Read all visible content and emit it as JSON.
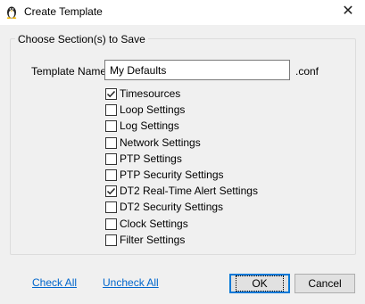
{
  "window": {
    "title": "Create Template",
    "icon": "penguin-icon",
    "close_glyph": "✕"
  },
  "group": {
    "title": "Choose Section(s) to Save"
  },
  "template_name": {
    "label": "Template Name:",
    "value": "My Defaults",
    "extension": ".conf"
  },
  "sections": [
    {
      "label": "Timesources",
      "checked": true
    },
    {
      "label": "Loop Settings",
      "checked": false
    },
    {
      "label": "Log Settings",
      "checked": false
    },
    {
      "label": "Network Settings",
      "checked": false
    },
    {
      "label": "PTP Settings",
      "checked": false
    },
    {
      "label": "PTP Security Settings",
      "checked": false
    },
    {
      "label": "DT2 Real-Time Alert Settings",
      "checked": true
    },
    {
      "label": "DT2 Security Settings",
      "checked": false
    },
    {
      "label": "Clock Settings",
      "checked": false
    },
    {
      "label": "Filter Settings",
      "checked": false
    }
  ],
  "links": {
    "check_all": "Check All",
    "uncheck_all": "Uncheck All"
  },
  "buttons": {
    "ok": "OK",
    "cancel": "Cancel"
  },
  "colors": {
    "link": "#0066cc",
    "default_button_border": "#0078d7",
    "dialog_background": "#f0f0f0"
  }
}
